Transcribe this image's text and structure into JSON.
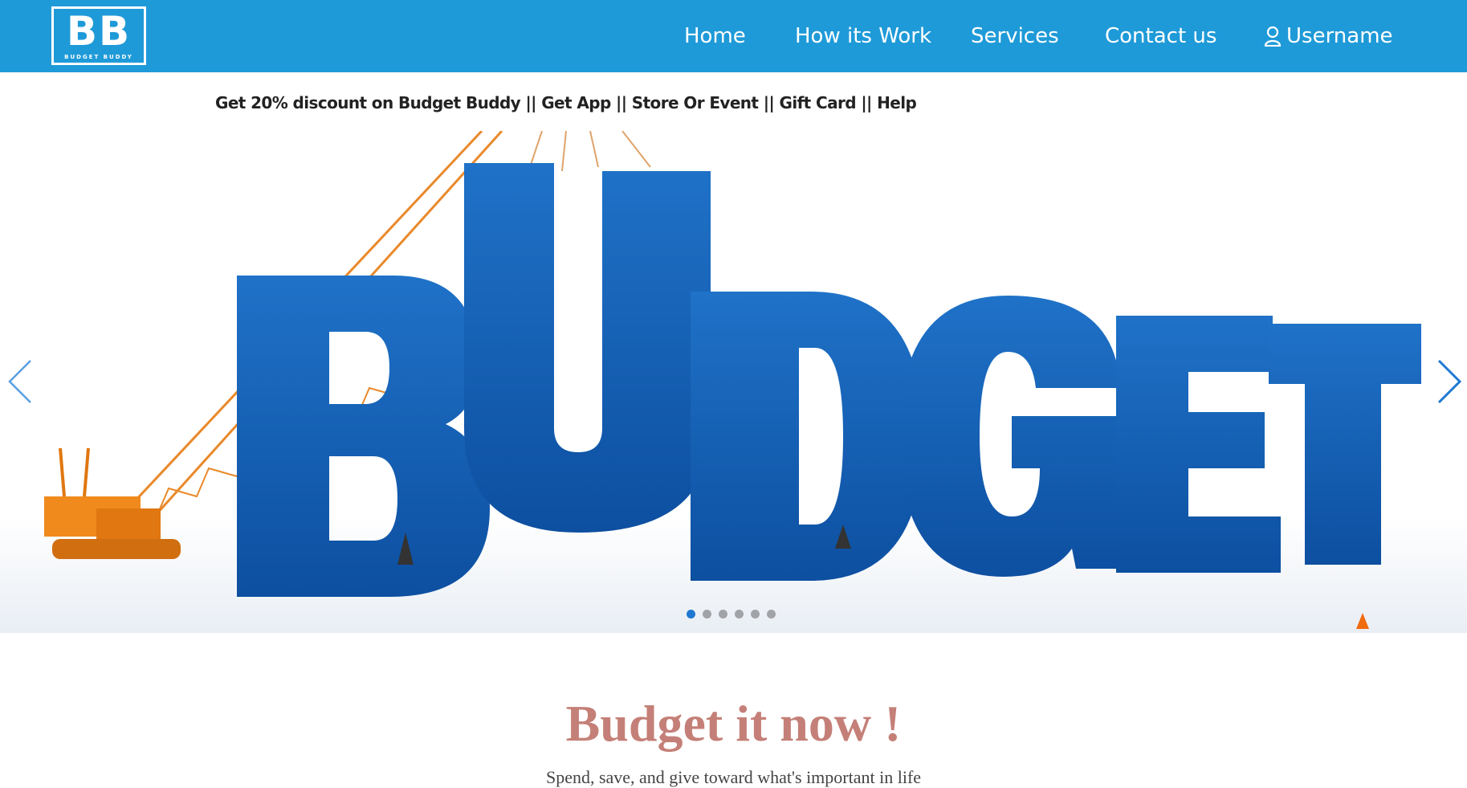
{
  "navbar": {
    "logo_mark": "BB",
    "logo_sub": "BUDGET BUDDY",
    "items": [
      {
        "label": "Home"
      },
      {
        "label": "How its Work"
      },
      {
        "label": "Services"
      },
      {
        "label": "Contact us"
      }
    ],
    "user_label": "Username",
    "user_icon": "user-icon",
    "background_color": "#1f9ad8"
  },
  "promo": {
    "text": "Get 20% discount on Budget Buddy || Get App || Store Or Event || Gift Card || Help"
  },
  "carousel": {
    "slide_text": "BUDGET",
    "prev_icon": "chevron-left-icon",
    "next_icon": "chevron-right-icon",
    "slide_count": 6,
    "active_slide": 1
  },
  "hero": {
    "headline": "Budget it now !",
    "tagline": "Spend, save, and give toward what's important in life",
    "headline_color": "#c48078"
  }
}
